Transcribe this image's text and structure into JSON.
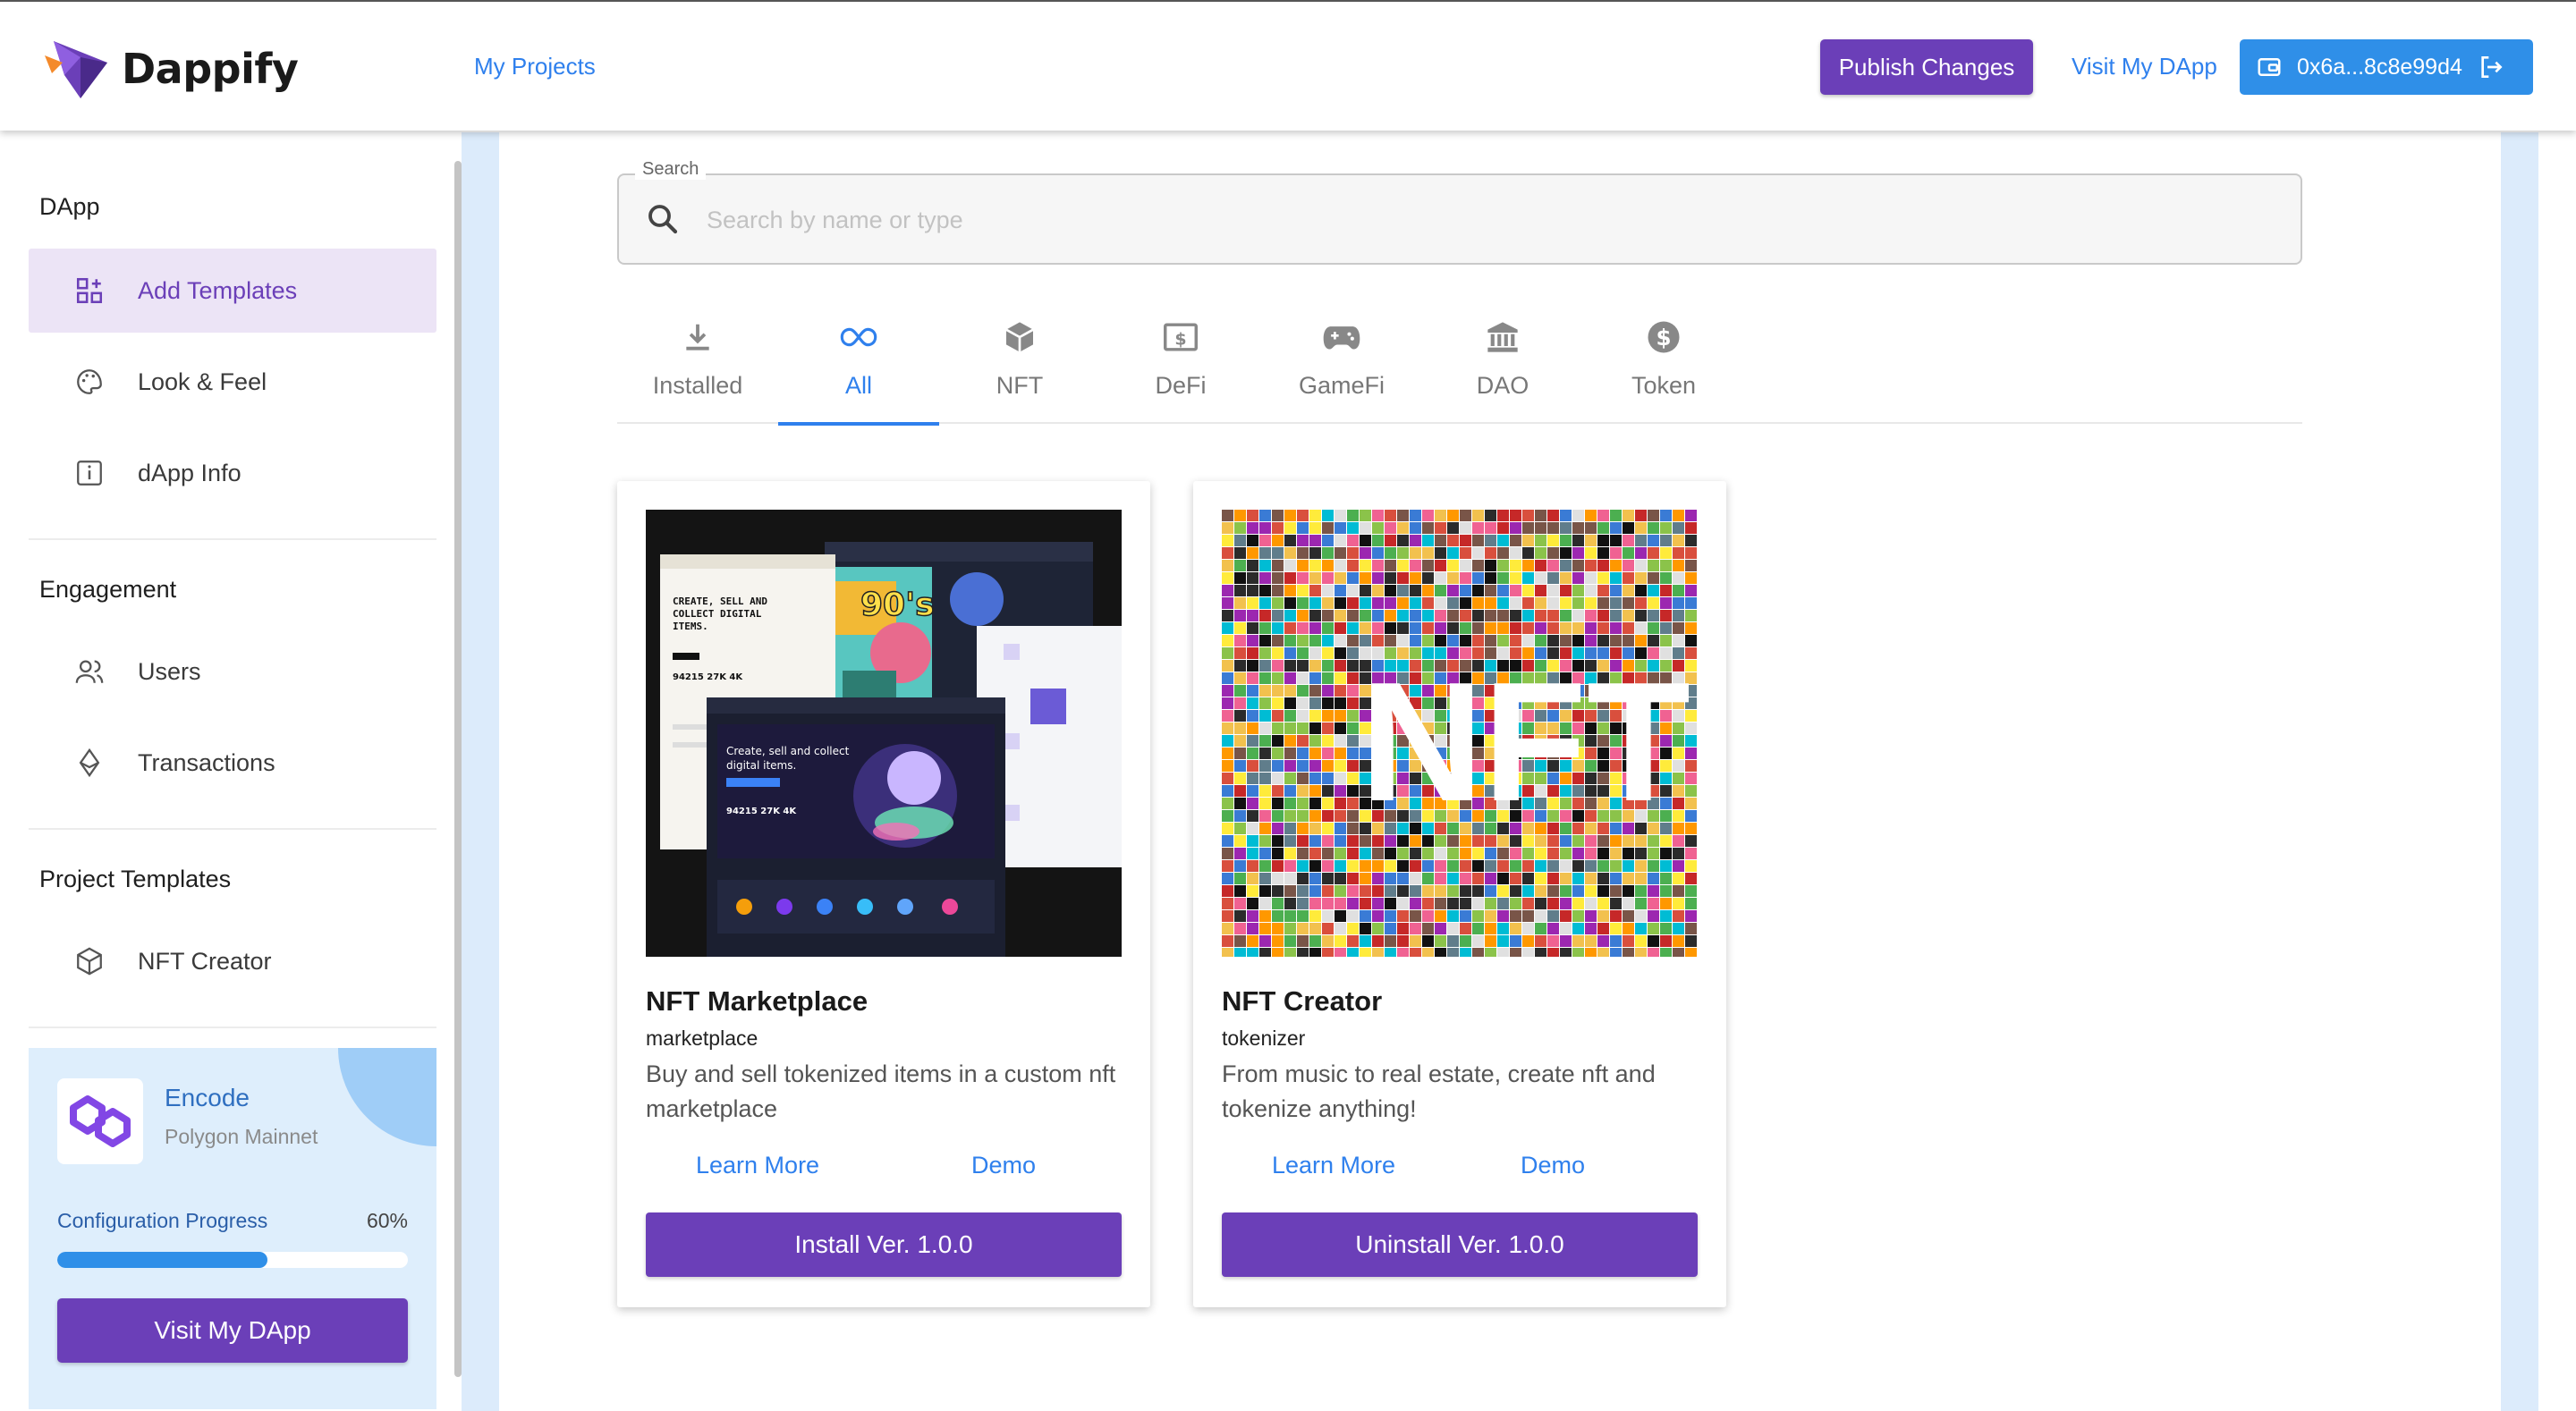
{
  "header": {
    "brand": "Dappify",
    "nav_my_projects": "My Projects",
    "publish_label": "Publish Changes",
    "visit_label": "Visit My DApp",
    "wallet_label": "0x6a...8c8e99d4"
  },
  "sidebar": {
    "sections": [
      {
        "title": "DApp",
        "items": [
          {
            "label": "Add Templates",
            "icon": "grid-plus-icon",
            "active": true
          },
          {
            "label": "Look & Feel",
            "icon": "palette-icon"
          },
          {
            "label": "dApp Info",
            "icon": "info-icon"
          }
        ]
      },
      {
        "title": "Engagement",
        "items": [
          {
            "label": "Users",
            "icon": "users-icon"
          },
          {
            "label": "Transactions",
            "icon": "ethereum-icon"
          }
        ]
      },
      {
        "title": "Project Templates",
        "items": [
          {
            "label": "NFT Creator",
            "icon": "cube-icon"
          }
        ]
      }
    ],
    "project": {
      "name": "Encode",
      "network": "Polygon Mainnet",
      "progress_label": "Configuration Progress",
      "progress_text": "60%",
      "progress_value": 0.6,
      "button_label": "Visit My DApp"
    }
  },
  "search": {
    "legend": "Search",
    "placeholder": "Search by name or type",
    "value": ""
  },
  "tabs": [
    {
      "label": "Installed",
      "icon": "download-icon"
    },
    {
      "label": "All",
      "icon": "infinity-icon",
      "active": true
    },
    {
      "label": "NFT",
      "icon": "cube-icon"
    },
    {
      "label": "DeFi",
      "icon": "dollar-bill-icon"
    },
    {
      "label": "GameFi",
      "icon": "gamepad-icon"
    },
    {
      "label": "DAO",
      "icon": "bank-icon"
    },
    {
      "label": "Token",
      "icon": "dollar-coin-icon"
    }
  ],
  "cards": [
    {
      "title": "NFT Marketplace",
      "subtitle": "marketplace",
      "description": "Buy and sell tokenized items in a custom nft marketplace",
      "learn_more": "Learn More",
      "demo": "Demo",
      "action": "Install Ver. 1.0.0",
      "thumb": {
        "headline": "CREATE, SELL AND COLLECT DIGITAL ITEMS.",
        "sub": "Create, sell and collect digital items."
      }
    },
    {
      "title": "NFT Creator",
      "subtitle": "tokenizer",
      "description": "From music to real estate, create nft and tokenize anything!",
      "learn_more": "Learn More",
      "demo": "Demo",
      "action": "Uninstall Ver. 1.0.0",
      "thumb": {
        "overlay": "NFT"
      }
    }
  ],
  "colors": {
    "accent_purple": "#6b3fb8",
    "accent_blue": "#2f8fe8",
    "link_blue": "#2f80ed"
  }
}
